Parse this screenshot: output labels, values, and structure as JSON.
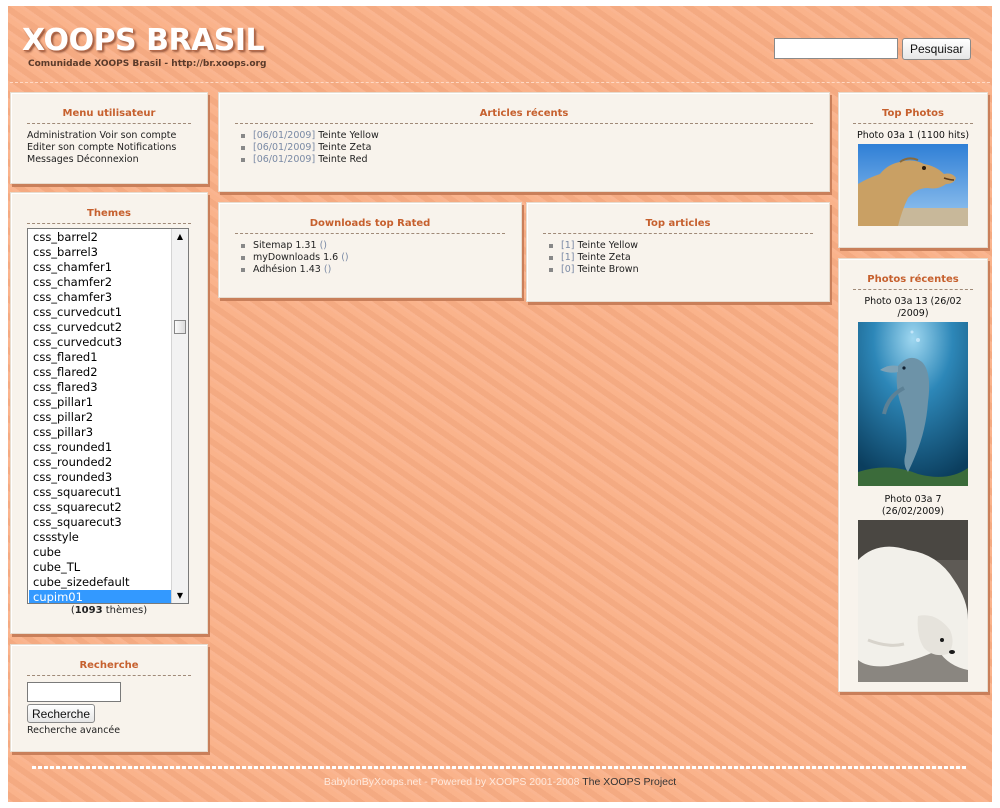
{
  "header": {
    "logo_title": "XOOPS BRASIL",
    "logo_subtitle": "Comunidade XOOPS Brasil - http://br.xoops.org",
    "search_value": "",
    "search_button": "Pesquisar"
  },
  "user_menu": {
    "title": "Menu utilisateur",
    "lines": [
      "Administration Voir son compte",
      "Editer son compte Notifications",
      "Messages Déconnexion"
    ]
  },
  "themes": {
    "title": "Themes",
    "items": [
      "css_barrel2",
      "css_barrel3",
      "css_chamfer1",
      "css_chamfer2",
      "css_chamfer3",
      "css_curvedcut1",
      "css_curvedcut2",
      "css_curvedcut3",
      "css_flared1",
      "css_flared2",
      "css_flared3",
      "css_pillar1",
      "css_pillar2",
      "css_pillar3",
      "css_rounded1",
      "css_rounded2",
      "css_rounded3",
      "css_squarecut1",
      "css_squarecut2",
      "css_squarecut3",
      "cssstyle",
      "cube",
      "cube_TL",
      "cube_sizedefault",
      "cupim01"
    ],
    "selected": "cupim01",
    "count_prefix": "(",
    "count": "1093",
    "count_suffix": " thèmes)"
  },
  "search_box": {
    "title": "Recherche",
    "input_value": "",
    "button": "Recherche",
    "advanced": "Recherche avancée"
  },
  "recent_articles": {
    "title": "Articles récents",
    "items": [
      {
        "date": "[06/01/2009]",
        "name": "Teinte Yellow"
      },
      {
        "date": "[06/01/2009]",
        "name": "Teinte Zeta"
      },
      {
        "date": "[06/01/2009]",
        "name": "Teinte Red"
      }
    ]
  },
  "downloads": {
    "title": "Downloads top Rated",
    "items": [
      {
        "name": "Sitemap 1.31",
        "extra": "()"
      },
      {
        "name": "myDownloads 1.6",
        "extra": "()"
      },
      {
        "name": "Adhésion 1.43",
        "extra": "()"
      }
    ]
  },
  "top_articles": {
    "title": "Top articles",
    "items": [
      {
        "count": "[1]",
        "name": "Teinte Yellow"
      },
      {
        "count": "[1]",
        "name": "Teinte Zeta"
      },
      {
        "count": "[0]",
        "name": "Teinte Brown"
      }
    ]
  },
  "top_photos": {
    "title": "Top Photos",
    "caption": "Photo 03a 1 (1100 hits)",
    "image": "camel-photo"
  },
  "recent_photos": {
    "title": "Photos récentes",
    "photos": [
      {
        "caption": "Photo 03a 13 (26/02 /2009)",
        "image": "dolphin-photo"
      },
      {
        "caption": "Photo 03a 7 (26/02/2009)",
        "image": "polar-bear-photo"
      }
    ]
  },
  "footer": {
    "text": "BabylonByXoops.net - Powered by XOOPS 2001-2008",
    "link": "The XOOPS Project"
  },
  "colors": {
    "background": "#f9ad84",
    "box_title": "#c6602e",
    "selection": "#3399ff"
  }
}
